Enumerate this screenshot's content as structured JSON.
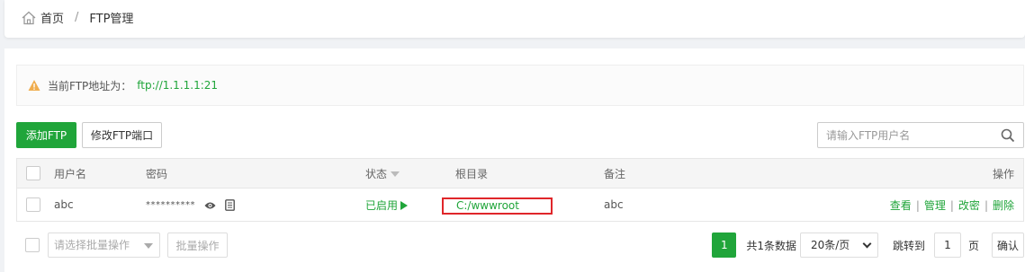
{
  "breadcrumb": {
    "home": "首页",
    "separator": "/",
    "current": "FTP管理"
  },
  "alert": {
    "label": "当前FTP地址为：",
    "url": "ftp://1.1.1.1:21"
  },
  "toolbar": {
    "add_label": "添加FTP",
    "port_label": "修改FTP端口",
    "search_placeholder": "请输入FTP用户名"
  },
  "table": {
    "headers": {
      "username": "用户名",
      "password": "密码",
      "status": "状态",
      "root": "根目录",
      "note": "备注",
      "ops": "操作"
    },
    "rows": [
      {
        "username": "abc",
        "password": "**********",
        "status": "已启用",
        "root": "C:/wwwroot",
        "note": "abc",
        "ops": [
          "查看",
          "管理",
          "改密",
          "删除"
        ]
      }
    ]
  },
  "footer": {
    "batch_placeholder": "请选择批量操作",
    "batch_button": "批量操作",
    "current_page": "1",
    "total_text": "共1条数据",
    "page_size": "20条/页",
    "jump_label": "跳转到",
    "jump_value": "1",
    "page_unit": "页",
    "confirm": "确认"
  },
  "colors": {
    "accent": "#20a53a",
    "highlight_border": "#e0262a",
    "warning": "#f0ad4e"
  }
}
